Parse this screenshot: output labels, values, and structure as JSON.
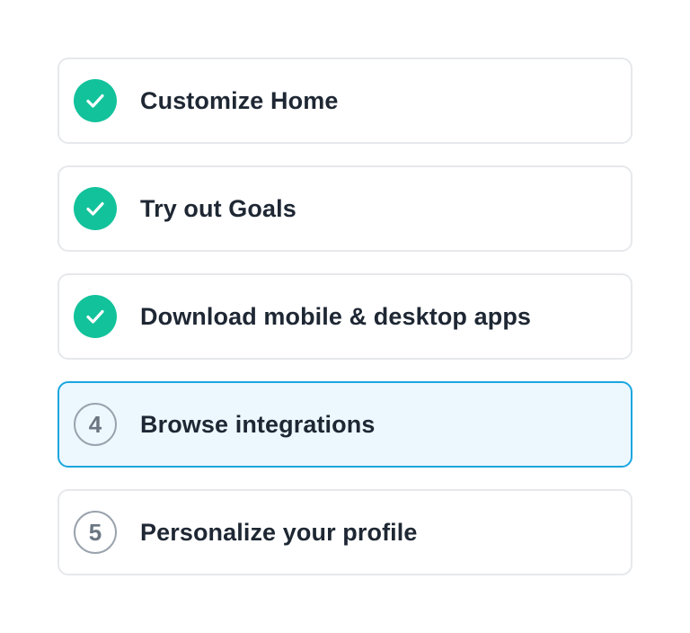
{
  "checklist": {
    "steps": [
      {
        "label": "Customize Home",
        "status": "done",
        "icon": "checkmark-icon"
      },
      {
        "label": "Try out Goals",
        "status": "done",
        "icon": "checkmark-icon"
      },
      {
        "label": "Download mobile & desktop apps",
        "status": "done",
        "icon": "checkmark-icon"
      },
      {
        "label": "Browse integrations",
        "status": "active",
        "number": "4"
      },
      {
        "label": "Personalize your profile",
        "status": "pending",
        "number": "5"
      }
    ]
  },
  "colors": {
    "done_green": "#12c29b",
    "active_border": "#1aa6e0",
    "active_background": "#ecf8fe",
    "text": "#1e2733",
    "pending_circle": "#9aa3ad"
  }
}
